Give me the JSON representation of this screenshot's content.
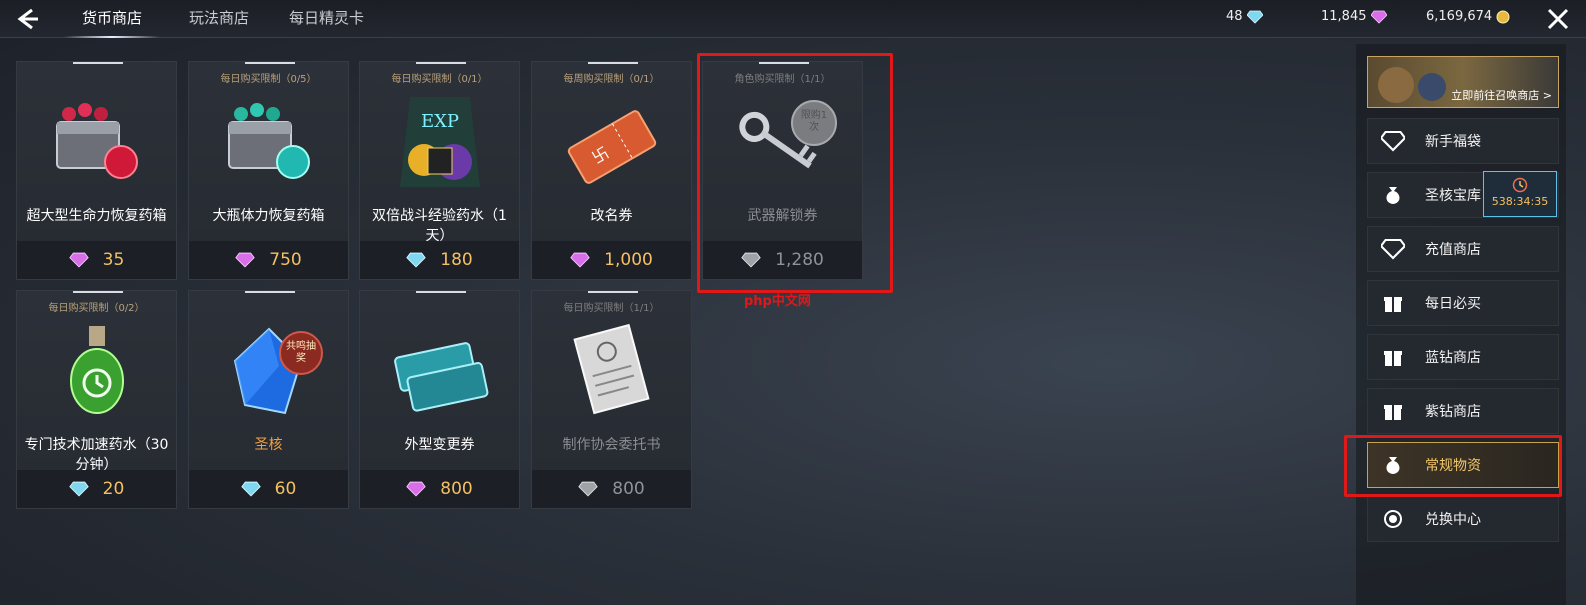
{
  "header": {
    "tabs": [
      {
        "label": "货币商店",
        "active": true
      },
      {
        "label": "玩法商店",
        "active": false
      },
      {
        "label": "每日精灵卡",
        "active": false
      }
    ],
    "currencies": [
      {
        "value": "48",
        "icon": "blue-diamond-icon"
      },
      {
        "value": "11,845",
        "icon": "purple-diamond-icon"
      },
      {
        "value": "6,169,674",
        "icon": "gold-coin-icon"
      }
    ]
  },
  "items": [
    {
      "name": "超大型生命力恢复药箱",
      "limit": "",
      "price": "35",
      "currency": "purple-diamond"
    },
    {
      "name": "大瓶体力恢复药箱",
      "limit": "每日购买限制（0/5）",
      "price": "750",
      "currency": "purple-diamond"
    },
    {
      "name": "双倍战斗经验药水（1天）",
      "limit": "每日购买限制（0/1）",
      "price": "180",
      "currency": "blue-diamond"
    },
    {
      "name": "改名券",
      "limit": "每周购买限制（0/1）",
      "price": "1,000",
      "currency": "purple-diamond"
    },
    {
      "name": "武器解锁券",
      "limit": "角色购买限制（1/1）",
      "price": "1,280",
      "currency": "grey-diamond",
      "badge": "限购1次"
    },
    {
      "name": "专门技术加速药水（30分钟）",
      "limit": "每日购买限制（0/2）",
      "price": "20",
      "currency": "blue-diamond"
    },
    {
      "name": "圣核",
      "limit": "",
      "price": "60",
      "currency": "blue-diamond",
      "badge": "共鸣抽奖"
    },
    {
      "name": "外型变更券",
      "limit": "",
      "price": "800",
      "currency": "purple-diamond"
    },
    {
      "name": "制作协会委托书",
      "limit": "每日购买限制（1/1）",
      "price": "800",
      "currency": "grey-diamond"
    }
  ],
  "sidebar": {
    "banner": "立即前往召唤商店 >",
    "timer": "538:34:35",
    "menu": [
      {
        "label": "新手福袋",
        "icon": "diamond-icon"
      },
      {
        "label": "圣核宝库",
        "icon": "money-bag-icon"
      },
      {
        "label": "充值商店",
        "icon": "diamond-icon"
      },
      {
        "label": "每日必买",
        "icon": "gift-icon"
      },
      {
        "label": "蓝钻商店",
        "icon": "gift-icon"
      },
      {
        "label": "紫钻商店",
        "icon": "gift-icon"
      },
      {
        "label": "常规物资",
        "icon": "money-bag-icon",
        "active": true
      },
      {
        "label": "兑换中心",
        "icon": "coin-exchange-icon"
      }
    ]
  },
  "watermark": "php中文网",
  "colors": {
    "accent_gold": "#f5c060",
    "highlight_red": "#e01818",
    "purple_diamond": "#d86ee8",
    "blue_diamond": "#7fd8f0"
  }
}
